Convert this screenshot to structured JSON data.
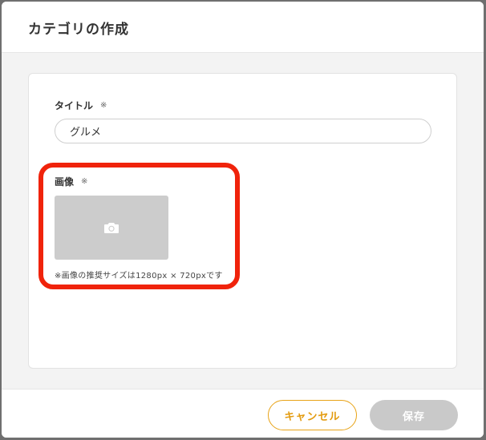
{
  "modal": {
    "title": "カテゴリの作成"
  },
  "form": {
    "title_field": {
      "label": "タイトル",
      "required_mark": "※",
      "value": "グルメ"
    },
    "image_field": {
      "label": "画像",
      "required_mark": "※",
      "icon": "camera-icon",
      "note": "※画像の推奨サイズは1280px × 720pxです"
    }
  },
  "footer": {
    "cancel_label": "キャンセル",
    "save_label": "保存"
  },
  "colors": {
    "accent": "#e8a317",
    "highlight": "#f0230b",
    "disabled_button": "#c9c9c9"
  }
}
